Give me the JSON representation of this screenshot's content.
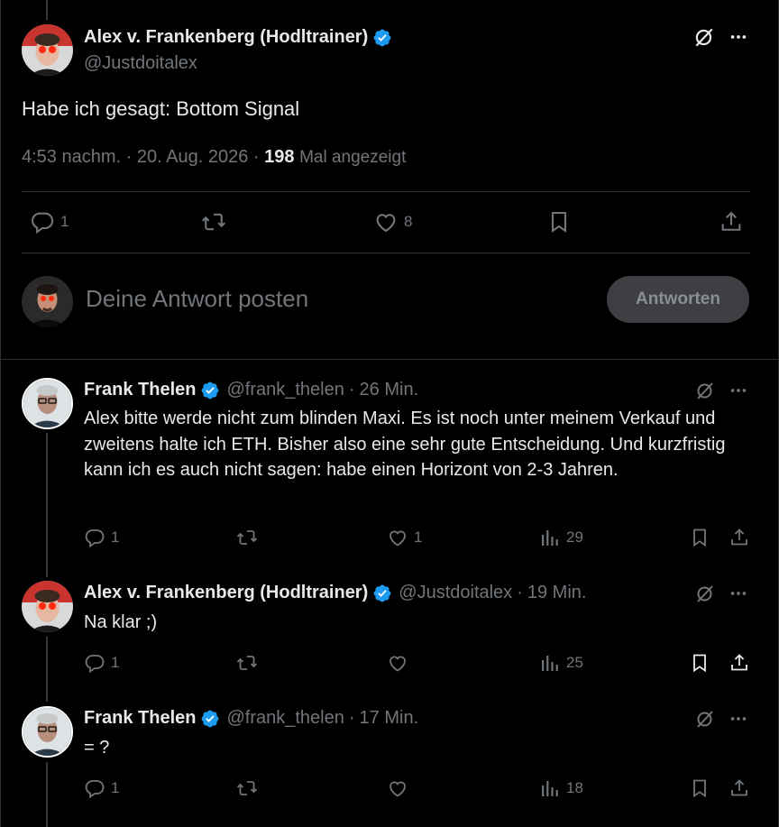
{
  "main_tweet": {
    "author_name": "Alex v. Frankenberg (Hodltrainer)",
    "handle": "@Justdoitalex",
    "text": "Habe ich gesagt: Bottom Signal",
    "time": "4:53 nachm.",
    "date": "20. Aug. 2026",
    "views": "198",
    "views_label": "Mal angezeigt",
    "replies": "1",
    "likes": "8"
  },
  "compose": {
    "placeholder": "Deine Antwort posten",
    "button_label": "Antworten"
  },
  "replies": [
    {
      "author_name": "Frank Thelen",
      "handle": "@frank_thelen",
      "age": "26 Min.",
      "text": "Alex bitte werde nicht zum blinden Maxi. Es ist noch unter meinem Verkauf und zweitens halte ich ETH. Bisher also eine sehr gute Entscheidung. Und kurzfristig kann ich es auch nicht sagen: habe einen Horizont von 2-3 Jahren.",
      "replies": "1",
      "likes": "1",
      "views": "29"
    },
    {
      "author_name": "Alex v. Frankenberg (Hodltrainer)",
      "handle": "@Justdoitalex",
      "age": "19 Min.",
      "text": "Na klar ;)",
      "replies": "1",
      "likes": "",
      "views": "25"
    },
    {
      "author_name": "Frank Thelen",
      "handle": "@frank_thelen",
      "age": "17 Min.",
      "text": "= ?",
      "replies": "1",
      "likes": "",
      "views": "18"
    }
  ],
  "separator": "·",
  "colors": {
    "background": "#000000",
    "text": "#e7e9ea",
    "muted": "#71767b",
    "verified": "#1d9bf0",
    "divider": "#2f3336"
  }
}
